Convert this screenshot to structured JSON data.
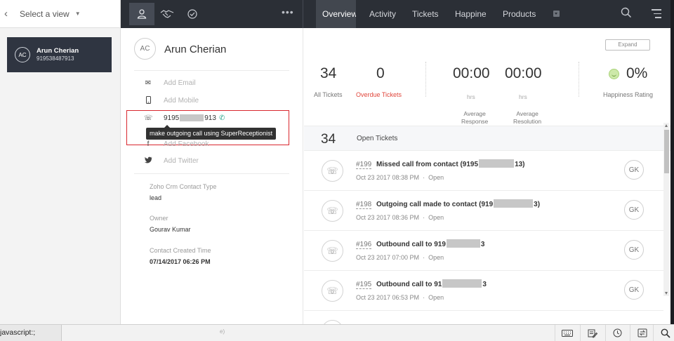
{
  "left": {
    "back_icon": "chevron-left-icon",
    "view_selector": "Select a view",
    "contact": {
      "initials": "AC",
      "name": "Arun Cherian",
      "phone": "919538487913"
    }
  },
  "topbar": {
    "icons": [
      "contact-icon",
      "handshake-icon",
      "check-circle-icon"
    ],
    "more": "•••",
    "tabs": [
      {
        "label": "Overview",
        "active": true
      },
      {
        "label": "Activity"
      },
      {
        "label": "Tickets"
      },
      {
        "label": "Happiness"
      },
      {
        "label": "Products"
      }
    ],
    "right_icons": [
      "search-icon",
      "menu-icon"
    ]
  },
  "contact": {
    "initials": "AC",
    "name": "Arun Cherian",
    "add_email": "Add Email",
    "add_mobile": "Add Mobile",
    "phone_start": "9195",
    "phone_end": "913",
    "tooltip": "make outgoing call using SuperReceptionist",
    "add_facebook": "Add Facebook",
    "add_twitter": "Add Twitter",
    "crm_type_label": "Zoho Crm Contact Type",
    "crm_type_value": "lead",
    "owner_label": "Owner",
    "owner_value": "Gourav Kumar",
    "created_label": "Contact Created Time",
    "created_value": "07/14/2017 06:26 PM"
  },
  "stats": {
    "expand": "Expand",
    "all_tickets": {
      "value": "34",
      "label": "All Tickets"
    },
    "overdue_tickets": {
      "value": "0",
      "label": "Overdue Tickets"
    },
    "avg_response": {
      "value": "00:00",
      "unit": "hrs",
      "label1": "Average",
      "label2": "Response"
    },
    "avg_resolution": {
      "value": "00:00",
      "unit": "hrs",
      "label1": "Average",
      "label2": "Resolution"
    },
    "happiness": {
      "value": "0%",
      "label": "Happiness Rating"
    }
  },
  "open_tickets": {
    "count": "34",
    "label": "Open Tickets"
  },
  "tickets": [
    {
      "number": "#199",
      "subject_start": "Missed call from contact (9195",
      "subject_end": "13)",
      "date": "Oct 23 2017 08:38 PM",
      "status": "Open",
      "assignee": "GK"
    },
    {
      "number": "#198",
      "subject_start": "Outgoing call made to contact (919",
      "subject_end": "3)",
      "date": "Oct 23 2017 08:36 PM",
      "status": "Open",
      "assignee": "GK"
    },
    {
      "number": "#196",
      "subject_start": "Outbound call to 919",
      "subject_end": "3",
      "date": "Oct 23 2017 07:00 PM",
      "status": "Open",
      "assignee": "GK"
    },
    {
      "number": "#195",
      "subject_start": "Outbound call to 91",
      "subject_end": "3",
      "date": "Oct 23 2017 06:53 PM",
      "status": "Open",
      "assignee": "GK"
    }
  ],
  "status_bar": {
    "url": "javascript:;",
    "faint": "e)",
    "icons": [
      "keyboard-icon",
      "edit-note-icon",
      "clock-icon",
      "transfer-icon",
      "search-icon"
    ]
  }
}
